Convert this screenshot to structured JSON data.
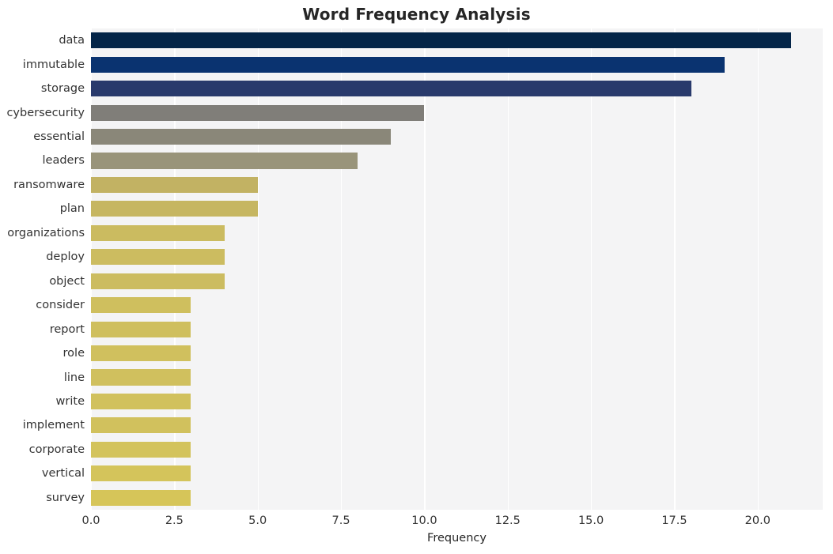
{
  "chart_data": {
    "type": "bar",
    "orientation": "horizontal",
    "title": "Word Frequency Analysis",
    "xlabel": "Frequency",
    "ylabel": "",
    "categories": [
      "data",
      "immutable",
      "storage",
      "cybersecurity",
      "essential",
      "leaders",
      "ransomware",
      "plan",
      "organizations",
      "deploy",
      "object",
      "consider",
      "report",
      "role",
      "line",
      "write",
      "implement",
      "corporate",
      "vertical",
      "survey"
    ],
    "values": [
      21,
      19,
      18,
      10,
      9,
      8,
      5,
      5,
      4,
      4,
      4,
      3,
      3,
      3,
      3,
      3,
      3,
      3,
      3,
      3
    ],
    "bar_colors": [
      "#042548",
      "#0a3370",
      "#293a6c",
      "#807e79",
      "#8a8779",
      "#99947a",
      "#c2b263",
      "#c6b661",
      "#cbbb60",
      "#ccbc60",
      "#ccbc60",
      "#cfbf5e",
      "#cfbf5e",
      "#d0c05e",
      "#d0c05e",
      "#d1c15d",
      "#d1c15d",
      "#d3c35c",
      "#d4c45b",
      "#d6c559"
    ],
    "xlim": [
      0,
      21.95
    ],
    "xticks": [
      "0.0",
      "2.5",
      "5.0",
      "7.5",
      "10.0",
      "12.5",
      "15.0",
      "17.5",
      "20.0"
    ],
    "xtick_values": [
      0,
      2.5,
      5,
      7.5,
      10,
      12.5,
      15,
      17.5,
      20
    ],
    "grid": "vertical-only",
    "legend": "none",
    "plot_background": "#f4f4f5",
    "grid_color": "#ffffff",
    "title_color": "#262626",
    "tick_label_color": "#333333"
  }
}
